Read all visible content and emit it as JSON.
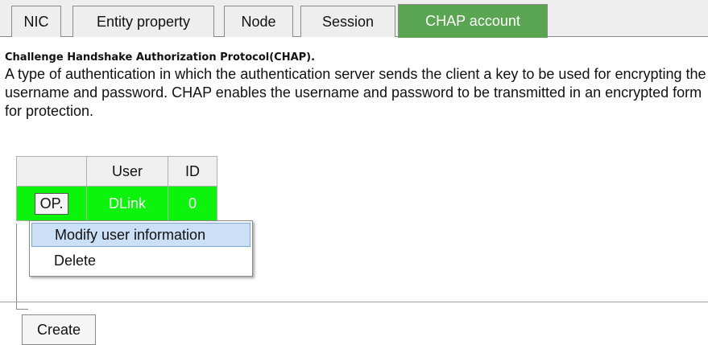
{
  "tabs": [
    {
      "label": "NIC"
    },
    {
      "label": "Entity property"
    },
    {
      "label": "Node"
    },
    {
      "label": "Session"
    },
    {
      "label": "CHAP account",
      "active": true
    }
  ],
  "colors": {
    "active_tab": "#5aa552",
    "selected_row": "#0cf40c",
    "menu_highlight": "#cbe0f7"
  },
  "section": {
    "heading": "Challenge Handshake Authorization Protocol(CHAP).",
    "description": "A type of authentication in which the authentication server sends the client a key to be used for encrypting the username and password. CHAP enables the username and password to be transmitted in an encrypted form for protection."
  },
  "table": {
    "headers": [
      "",
      "User",
      "ID"
    ],
    "rows": [
      {
        "op": "OP.",
        "user": "DLink",
        "id": "0"
      }
    ]
  },
  "context_menu": {
    "items": [
      {
        "label": "Modify user information",
        "highlighted": true
      },
      {
        "label": "Delete"
      }
    ]
  },
  "actions": {
    "create": "Create"
  }
}
